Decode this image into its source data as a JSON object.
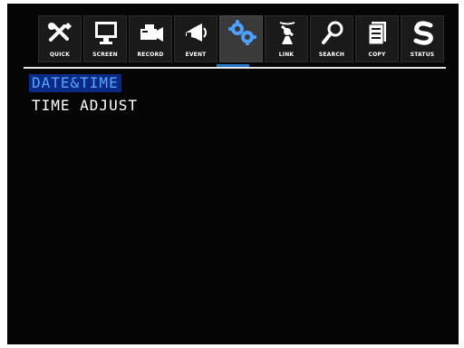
{
  "toolbar": {
    "items": [
      {
        "label": "QUICK",
        "icon": "quick-icon"
      },
      {
        "label": "SCREEN",
        "icon": "screen-icon"
      },
      {
        "label": "RECORD",
        "icon": "record-icon"
      },
      {
        "label": "EVENT",
        "icon": "event-icon"
      },
      {
        "label": "",
        "icon": "settings-icon",
        "active": true
      },
      {
        "label": "LINK",
        "icon": "link-icon"
      },
      {
        "label": "SEARCH",
        "icon": "search-icon"
      },
      {
        "label": "COPY",
        "icon": "copy-icon"
      },
      {
        "label": "STATUS",
        "icon": "status-icon"
      }
    ]
  },
  "menu": {
    "items": [
      {
        "label": "DATE&TIME",
        "selected": true
      },
      {
        "label": "TIME ADJUST",
        "selected": false
      }
    ]
  },
  "colors": {
    "accent": "#2b78c9",
    "selection_bg": "#0a2a86",
    "selection_text": "#57a7ff",
    "background": "#050505"
  }
}
